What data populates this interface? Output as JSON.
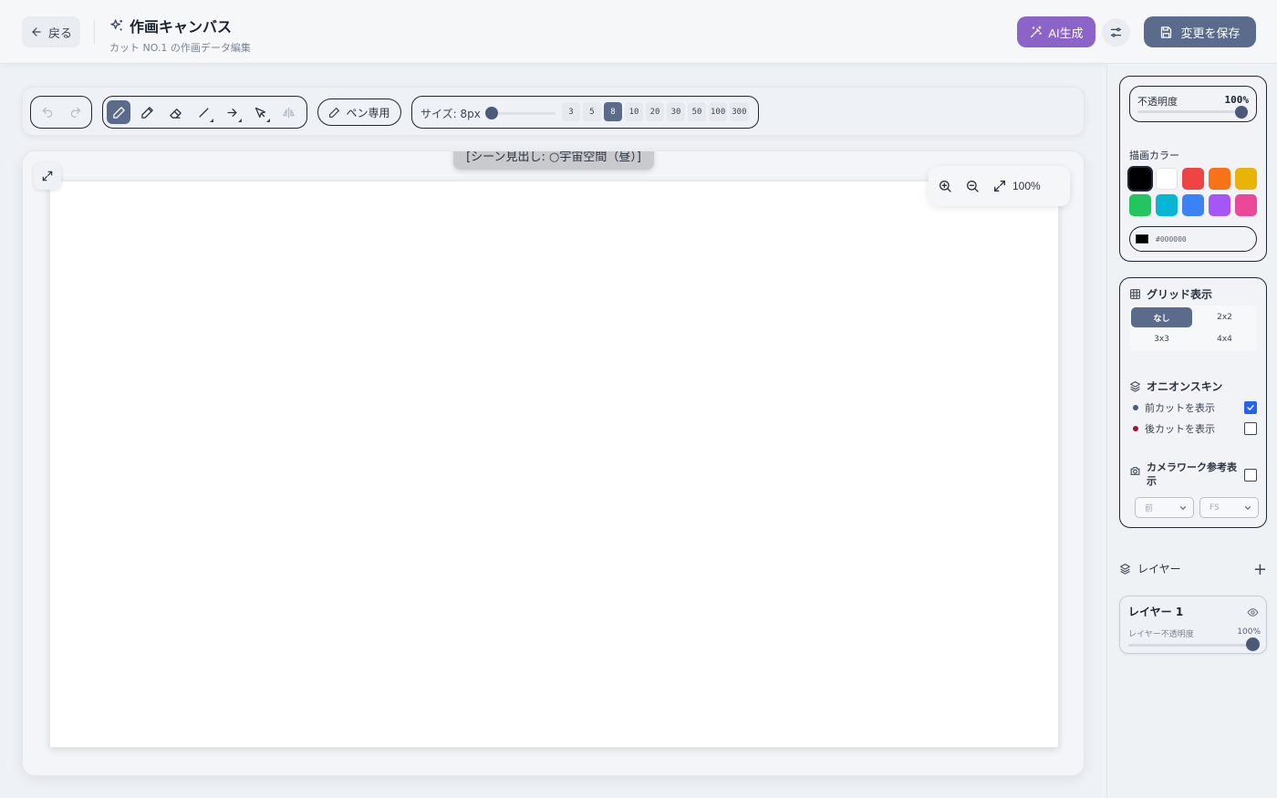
{
  "header": {
    "back_label": "戻る",
    "title": "作画キャンバス",
    "subtitle": "カット NO.1 の作画データ編集",
    "ai_label": "AI生成",
    "save_label": "変更を保存"
  },
  "toolbar": {
    "pen_only_label": "ペン専用",
    "size_label": "サイズ: 8px",
    "size_value": 8,
    "size_options": [
      "3",
      "5",
      "8",
      "10",
      "20",
      "30",
      "50",
      "100",
      "300"
    ],
    "active_size": "8"
  },
  "canvas": {
    "scene_heading": "[シーン見出し: ○宇宙空間（昼）]",
    "zoom_label": "100%"
  },
  "sidebar": {
    "opacity_label": "不透明度",
    "opacity_value": "100%",
    "color_label": "描画カラー",
    "colors": [
      "#000000",
      "#ffffff",
      "#ef4444",
      "#f97316",
      "#eab308",
      "#22c55e",
      "#06b6d4",
      "#3b82f6",
      "#a855f7",
      "#ec4899"
    ],
    "hex_value": "#000000",
    "grid_title": "グリッド表示",
    "grid_options": [
      "なし",
      "2x2",
      "3x3",
      "4x4"
    ],
    "onion_title": "オニオンスキン",
    "onion_prev_label": "前カットを表示",
    "onion_next_label": "後カットを表示",
    "onion_prev_checked": true,
    "onion_next_checked": false,
    "camera_title": "カメラワーク参考表示",
    "camera_checked": false,
    "camera_select_1": "前",
    "camera_select_2": "FS",
    "layers_title": "レイヤー",
    "layer_name": "レイヤー 1",
    "layer_opacity_label": "レイヤー不透明度",
    "layer_opacity_value": "100%"
  },
  "accent": {
    "primary": "#5a6b8c",
    "ai": "#8b63c9",
    "check": "#2563eb",
    "onion_prev_dot": "#4a5a78",
    "onion_next_dot": "#9f1239"
  }
}
